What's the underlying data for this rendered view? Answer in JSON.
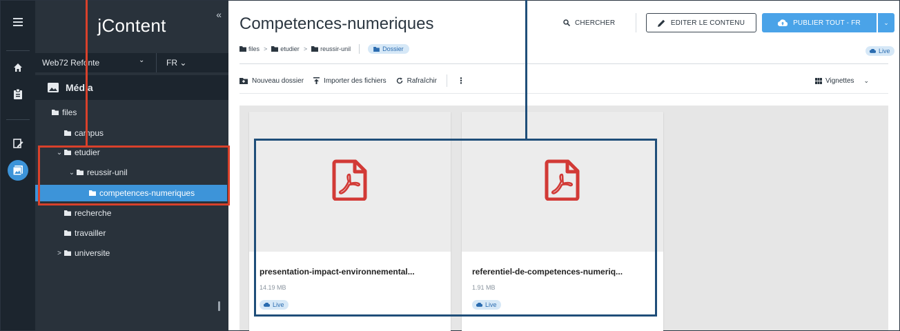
{
  "app": {
    "brand": "jContent",
    "collapse_glyph": "«"
  },
  "rail": {
    "items": [
      {
        "icon": "menu-icon"
      },
      {
        "icon": "home-icon"
      },
      {
        "icon": "clipboard-icon"
      },
      {
        "icon": "edit-document-icon"
      },
      {
        "icon": "media-icon",
        "active": true
      }
    ]
  },
  "nav": {
    "site": "Web72 Refonte",
    "site_chevron": "⌄",
    "language": "FR ⌄",
    "section_title": "Média",
    "tree": [
      {
        "label": "files",
        "depth": 0,
        "chevron": "",
        "selected": false
      },
      {
        "label": "campus",
        "depth": 1,
        "chevron": "",
        "selected": false
      },
      {
        "label": "etudier",
        "depth": 1,
        "chevron": "⌄",
        "selected": false
      },
      {
        "label": "reussir-unil",
        "depth": 2,
        "chevron": "⌄",
        "selected": false
      },
      {
        "label": "competences-numeriques",
        "depth": 3,
        "chevron": "",
        "selected": true
      },
      {
        "label": "recherche",
        "depth": 1,
        "chevron": "",
        "selected": false
      },
      {
        "label": "travailler",
        "depth": 1,
        "chevron": "",
        "selected": false
      },
      {
        "label": "universite",
        "depth": 1,
        "chevron": ">",
        "selected": false
      }
    ]
  },
  "main": {
    "title": "Competences-numeriques",
    "breadcrumb": [
      "files",
      "etudier",
      "reussir-unil"
    ],
    "breadcrumb_separator": ">",
    "type_badge": "Dossier",
    "search_label": "CHERCHER",
    "edit_label": "EDITER LE CONTENU",
    "publish_label": "PUBLIER TOUT - FR",
    "publish_more_glyph": "⌄",
    "status": "Live",
    "toolbar": {
      "new_folder": "Nouveau dossier",
      "import_files": "Importer des fichiers",
      "refresh": "Rafraîchir",
      "more_glyph": "⋮",
      "view_mode": "Vignettes",
      "view_chevron": "⌄"
    },
    "files": [
      {
        "name": "presentation-impact-environnemental...",
        "size": "14.19 MB",
        "status": "Live",
        "type": "pdf"
      },
      {
        "name": "referentiel-de-competences-numeriq...",
        "size": "1.91 MB",
        "status": "Live",
        "type": "pdf"
      }
    ]
  },
  "colors": {
    "rail_bg": "#1c252e",
    "nav_bg": "#29323b",
    "accent": "#3d94d9",
    "publish": "#4aa3e8",
    "pdf_red": "#d23a36",
    "annotation_red": "#d9412b",
    "annotation_blue": "#1f4e79"
  }
}
